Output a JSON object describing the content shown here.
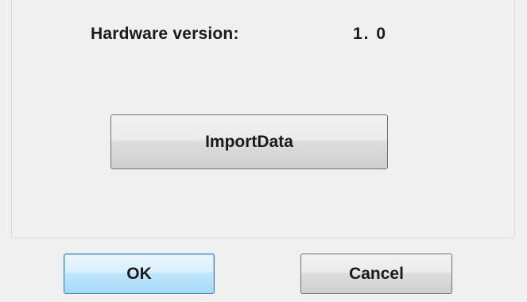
{
  "panel": {
    "hardware_version_label": "Hardware version:",
    "hardware_version_value": "1. 0",
    "import_button_label": "ImportData"
  },
  "footer": {
    "ok_label": "OK",
    "cancel_label": "Cancel"
  },
  "colors": {
    "dialog_background": "#f0f0f0",
    "default_button_border": "#3c7fb1",
    "button_border": "#707070"
  }
}
